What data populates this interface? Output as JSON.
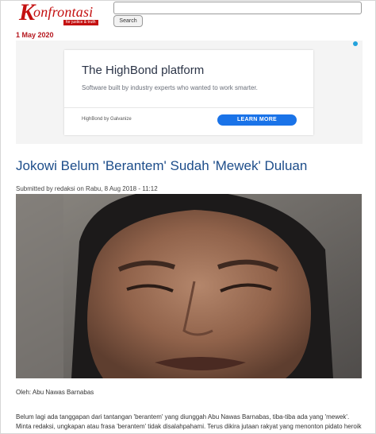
{
  "header": {
    "logo_letter": "K",
    "logo_text": "onfrontasi",
    "logo_tagline": "for justice & truth",
    "search": {
      "value": "",
      "button_label": "Search"
    }
  },
  "date": "1 May 2020",
  "ad": {
    "title": "The HighBond platform",
    "subtitle": "Software built by industry experts who wanted to work smarter.",
    "brand": "HighBond by Galvanize",
    "cta_label": "LEARN MORE",
    "cta_color": "#1a73e8",
    "adchoices_icon": "adchoices-icon"
  },
  "article": {
    "title": "Jokowi Belum 'Berantem' Sudah 'Mewek' Duluan",
    "submitted": "Submitted by redaksi on Rabu, 8 Aug 2018 - 11:12",
    "author_line": "Oleh: Abu Nawas Barnabas",
    "paragraph_lines": [
      "Belum lagi ada tanggapan dari tantangan 'berantem' yang diunggah Abu Nawas Barnabas, tiba-tiba ada yang 'mewek'.",
      "Minta redaksi, ungkapan atau frasa 'berantem' tidak disalahpahami. Terus dikira jutaan rakyat yang menonton pidato heroik"
    ]
  },
  "colors": {
    "brand_red": "#c41010",
    "date_red": "#b5161d",
    "headline_blue": "#1d4d8a"
  }
}
